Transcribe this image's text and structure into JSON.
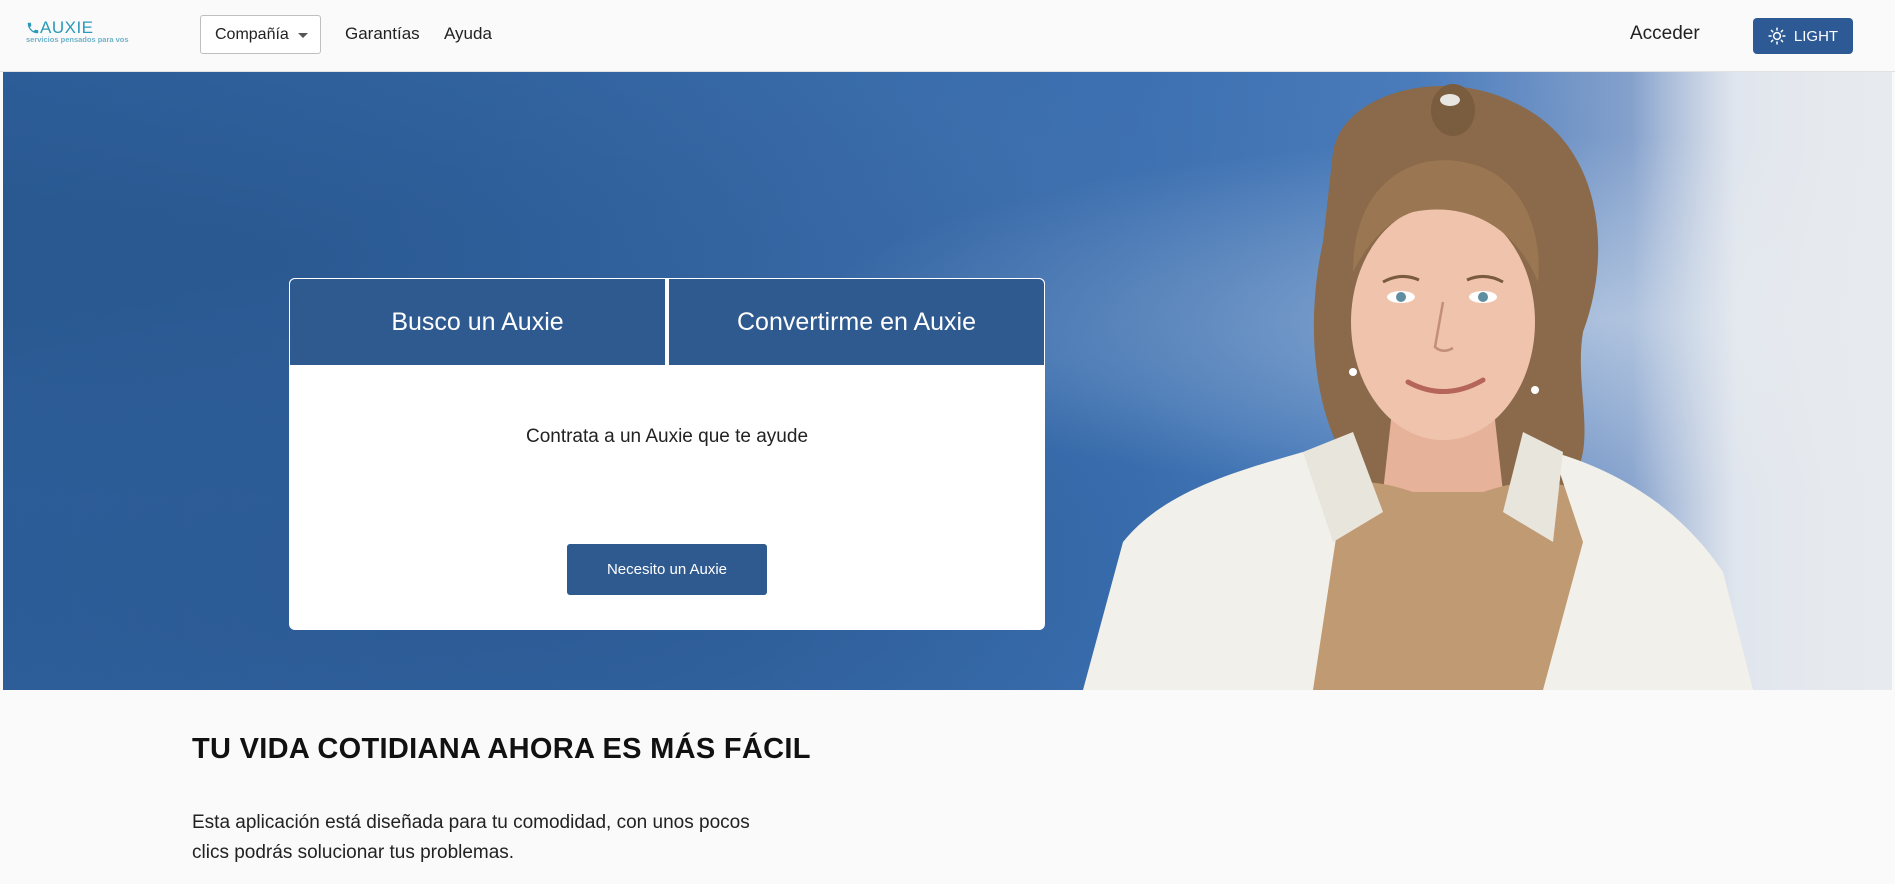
{
  "header": {
    "logo_text": "AUXIE",
    "logo_tagline": "servicios pensados para vos",
    "company_dropdown": "Compañía",
    "nav": {
      "guarantees": "Garantías",
      "help": "Ayuda"
    },
    "login": "Acceder",
    "theme_button": "LIGHT",
    "icons": {
      "logo": "phone-icon",
      "theme": "sun-icon",
      "dropdown": "caret-down-icon"
    }
  },
  "hero": {
    "tabs": [
      "Busco un Auxie",
      "Convertirme en Auxie"
    ],
    "card_text": "Contrata a un Auxie que te ayude",
    "cta_label": "Necesito un Auxie"
  },
  "section": {
    "title": "TU VIDA COTIDIANA AHORA ES MÁS FÁCIL",
    "body": "Esta aplicación está diseñada para tu comodidad, con unos pocos clics podrás solucionar tus problemas."
  },
  "colors": {
    "primary": "#2f5a8f",
    "logo": "#2a9ab8",
    "hero_blue": "#3568a6"
  }
}
